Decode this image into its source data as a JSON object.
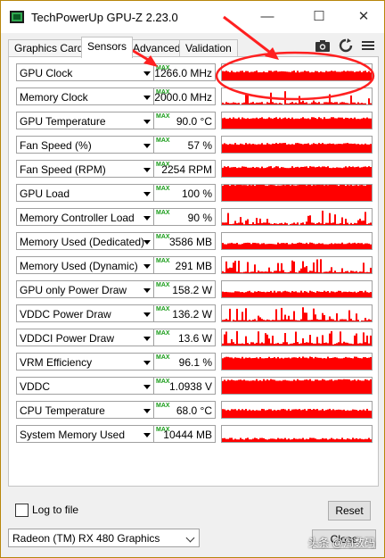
{
  "window": {
    "title": "TechPowerUp GPU-Z 2.23.0"
  },
  "tabs": [
    {
      "label": "Graphics Card"
    },
    {
      "label": "Sensors"
    },
    {
      "label": "Advanced"
    },
    {
      "label": "Validation"
    }
  ],
  "sensors": [
    {
      "name": "GPU Clock",
      "value": "1266.0 MHz",
      "max": "MAX"
    },
    {
      "name": "Memory Clock",
      "value": "2000.0 MHz",
      "max": "MAX"
    },
    {
      "name": "GPU Temperature",
      "value": "90.0 °C",
      "max": "MAX"
    },
    {
      "name": "Fan Speed (%)",
      "value": "57 %",
      "max": "MAX"
    },
    {
      "name": "Fan Speed (RPM)",
      "value": "2254 RPM",
      "max": "MAX"
    },
    {
      "name": "GPU Load",
      "value": "100 %",
      "max": "MAX"
    },
    {
      "name": "Memory Controller Load",
      "value": "90 %",
      "max": "MAX"
    },
    {
      "name": "Memory Used (Dedicated)",
      "value": "3586 MB",
      "max": "MAX"
    },
    {
      "name": "Memory Used (Dynamic)",
      "value": "291 MB",
      "max": "MAX"
    },
    {
      "name": "GPU only Power Draw",
      "value": "158.2 W",
      "max": "MAX"
    },
    {
      "name": "VDDC Power Draw",
      "value": "136.2 W",
      "max": "MAX"
    },
    {
      "name": "VDDCI Power Draw",
      "value": "13.6 W",
      "max": "MAX"
    },
    {
      "name": "VRM Efficiency",
      "value": "96.1 %",
      "max": "MAX"
    },
    {
      "name": "VDDC",
      "value": "1.0938 V",
      "max": "MAX"
    },
    {
      "name": "CPU Temperature",
      "value": "68.0 °C",
      "max": "MAX"
    },
    {
      "name": "System Memory Used",
      "value": "10444 MB",
      "max": "MAX"
    }
  ],
  "graph_levels": [
    0.55,
    0.1,
    0.65,
    0.55,
    0.6,
    1.0,
    0.1,
    0.35,
    0.1,
    0.35,
    0.1,
    0.15,
    0.75,
    0.85,
    0.5,
    0.2
  ],
  "footer": {
    "log_label": "Log to file",
    "reset_label": "Reset",
    "gpu_select": "Radeon (TM) RX 480 Graphics",
    "close_label": "Close"
  },
  "watermark": "头条 @淘数码",
  "colors": {
    "graph": "#ff0000",
    "max": "#1a9c1a",
    "annotation": "#ff2020"
  }
}
